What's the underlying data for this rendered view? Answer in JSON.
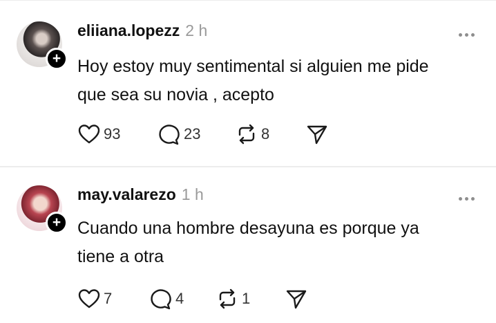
{
  "posts": [
    {
      "username": "eliiana.lopezz",
      "time": "2 h",
      "text_line1": "Hoy estoy muy sentimental si alguien me pide",
      "text_line2": "que sea su novia , acepto",
      "likes": "93",
      "replies": "23",
      "reposts": "8",
      "follow_symbol": "+"
    },
    {
      "username": "may.valarezo",
      "time": "1 h",
      "text_line1": "Cuando una hombre desayuna es porque ya",
      "text_line2": "tiene a otra",
      "likes": "7",
      "replies": "4",
      "reposts": "1",
      "follow_symbol": "+"
    }
  ],
  "icons": {
    "like": "heart-icon",
    "reply": "comment-icon",
    "repost": "repost-icon",
    "share": "send-icon",
    "more": "more-horizontal-icon"
  },
  "colors": {
    "text": "#111111",
    "muted": "#9a9a9a",
    "divider": "#ececec",
    "icon": "#1a1a1a"
  }
}
